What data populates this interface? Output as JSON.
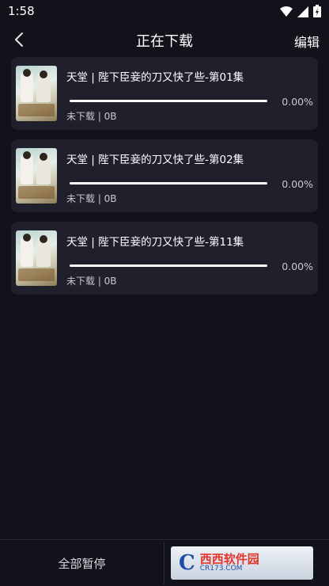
{
  "status_bar": {
    "time": "1:58"
  },
  "header": {
    "title": "正在下载",
    "edit_label": "编辑"
  },
  "downloads": [
    {
      "title": "天堂 | 陛下臣妾的刀又快了些-第01集",
      "percent": "0.00%",
      "progress": 0,
      "status": "未下载 | 0B"
    },
    {
      "title": "天堂 | 陛下臣妾的刀又快了些-第02集",
      "percent": "0.00%",
      "progress": 0,
      "status": "未下载 | 0B"
    },
    {
      "title": "天堂 | 陛下臣妾的刀又快了些-第11集",
      "percent": "0.00%",
      "progress": 0,
      "status": "未下载 | 0B"
    }
  ],
  "bottom_bar": {
    "pause_all_label": "全部暂停"
  },
  "watermark": {
    "main": "西西软件园",
    "sub": "CR173.COM"
  },
  "colors": {
    "background": "#11121a",
    "card": "#1f202c",
    "progress_track": "#ffffff",
    "progress_fill": "#ff5a4e"
  }
}
